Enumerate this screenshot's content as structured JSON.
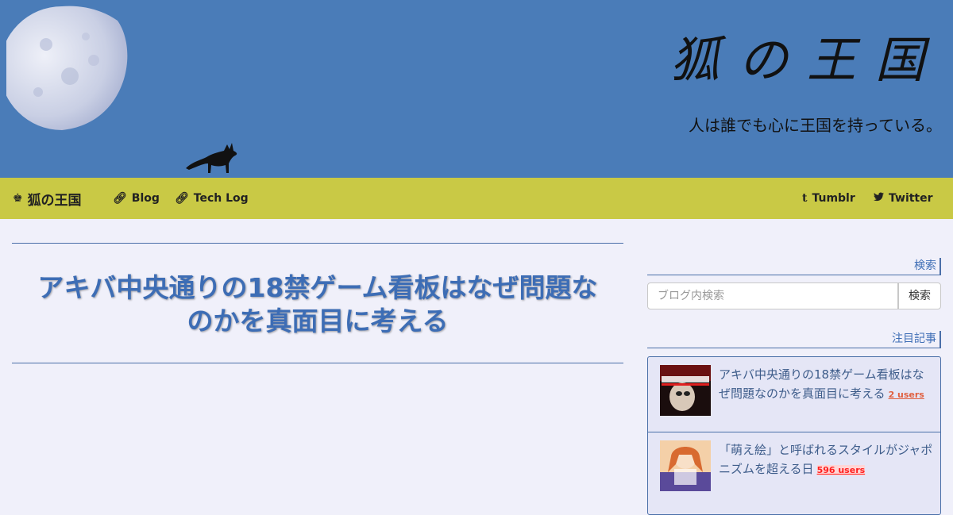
{
  "header": {
    "site_title": "狐の王国",
    "tagline": "人は誰でも心に王国を持っている。",
    "colors": {
      "header_bg": "#4a7cb8",
      "nav_bg": "#c9c945",
      "accent": "#3d6db5"
    }
  },
  "nav": {
    "brand": {
      "icon": "chess-king-icon",
      "label": "狐の王国"
    },
    "left_links": [
      {
        "icon": "link-icon",
        "label": "Blog"
      },
      {
        "icon": "link-icon",
        "label": "Tech Log"
      }
    ],
    "right_links": [
      {
        "icon": "tumblr-icon",
        "label": "Tumblr"
      },
      {
        "icon": "twitter-icon",
        "label": "Twitter"
      }
    ]
  },
  "main": {
    "post_title": "アキバ中央通りの18禁ゲーム看板はなぜ問題なのかを真面目に考える"
  },
  "sidebar": {
    "search": {
      "heading": "検索",
      "placeholder": "ブログ内検索",
      "button_label": "検索"
    },
    "featured": {
      "heading": "注目記事",
      "items": [
        {
          "title": "アキバ中央通りの18禁ゲーム看板はなぜ問題なのかを真面目に考える",
          "users": "2 users"
        },
        {
          "title": "「萌え絵」と呼ばれるスタイルがジャポニズムを超える日",
          "users": "596 users"
        }
      ]
    }
  }
}
